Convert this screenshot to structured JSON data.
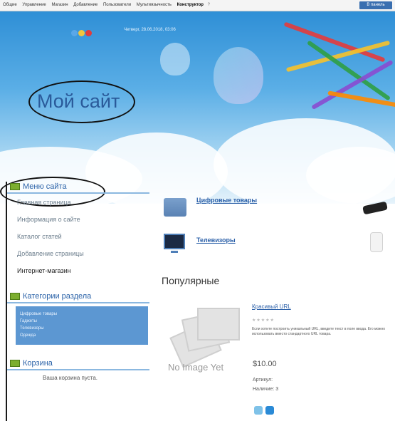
{
  "topbar": {
    "menu": [
      "Общие",
      "Управление",
      "Магазин",
      "Добавление",
      "Пользователи",
      "Мультиязычность",
      "Конструктор"
    ],
    "active_item": "Конструктор",
    "help": "?",
    "admin_button": "В панель"
  },
  "header": {
    "datetime": "Четверг, 28.06.2018, 03:06",
    "site_title": "Мой сайт"
  },
  "sidebar": {
    "menu_title": "Меню сайта",
    "menu_items": [
      "Главная страница",
      "Информация о сайте",
      "Каталог статей",
      "Добавление страницы",
      "Интернет-магазин"
    ],
    "categories_title": "Категории раздела",
    "categories": [
      "Цифровые товары",
      "Гаджеты",
      "Телевизоры",
      "Одежда"
    ],
    "cart_title": "Корзина",
    "cart_empty": "Ваша корзина пуста."
  },
  "main": {
    "categories": [
      {
        "label": "Цифровые товары"
      },
      {
        "label": "Телевизоры"
      }
    ],
    "popular_title": "Популярные",
    "product": {
      "no_image": "No Image Yet",
      "title": "Красивый URL",
      "stars": "★★★★★",
      "description": "Если хотите построить уникальный URL, введите текст в поле ввода. Его можно использовать вместо стандартного URL товара.",
      "price": "$10.00",
      "sku_label": "Артикул:",
      "stock": "Наличие: 3"
    }
  },
  "colors": {
    "accent": "#2a5fa8",
    "sky_top": "#2f8fd6",
    "category_box": "#5c97d2",
    "menu_icon": "#7cae2f"
  }
}
